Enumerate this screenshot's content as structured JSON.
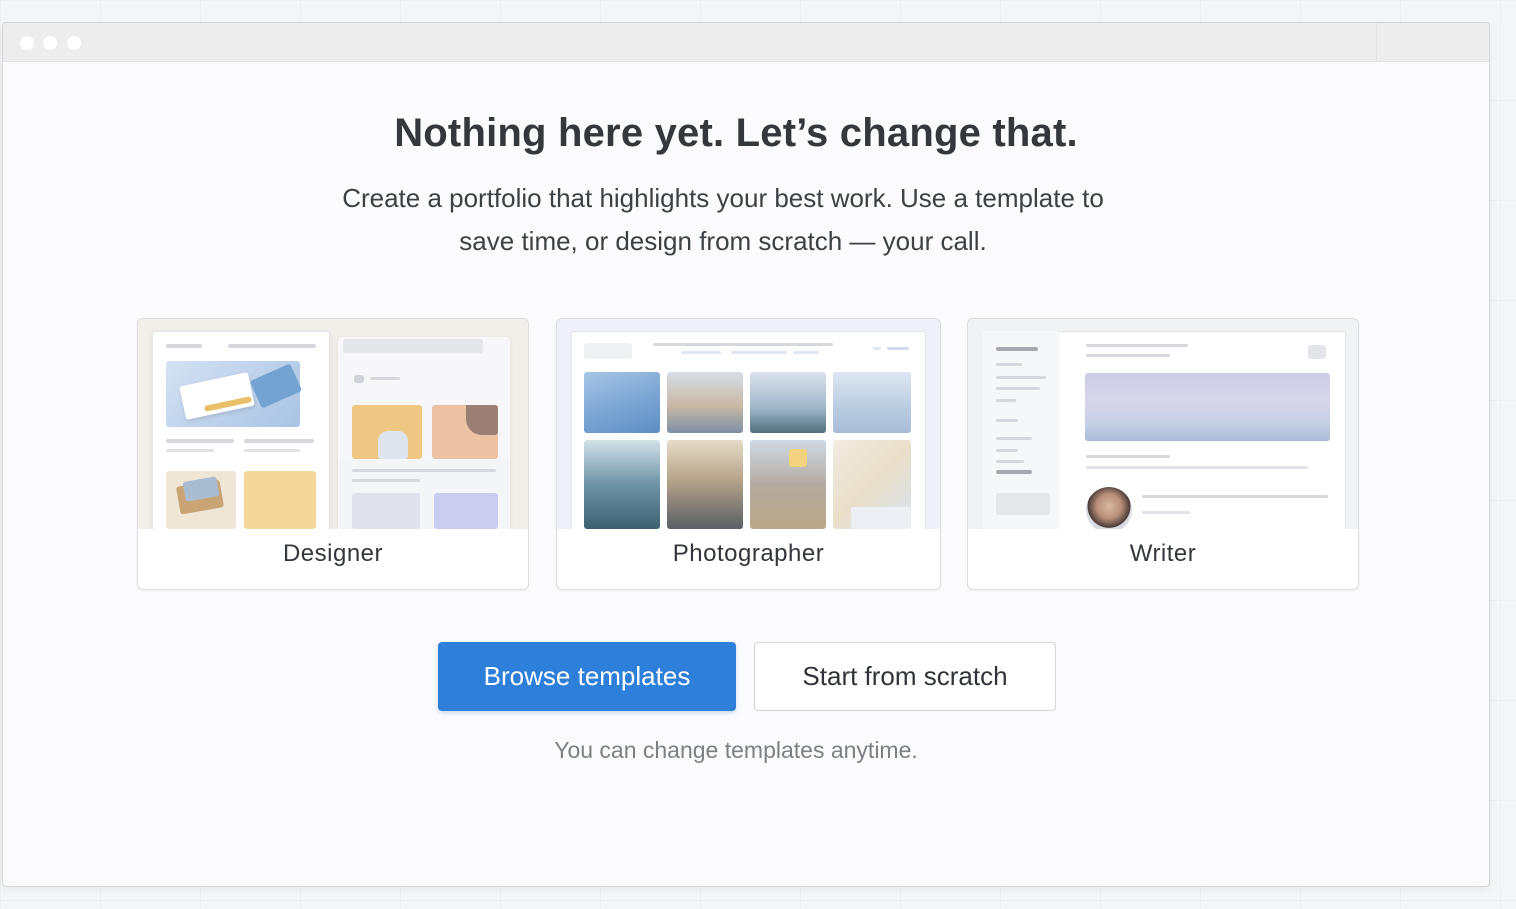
{
  "window": {
    "controls": [
      "window-dot-icon",
      "window-dot-icon",
      "window-dot-icon"
    ]
  },
  "empty_state": {
    "headline": "Nothing here yet. Let’s change that.",
    "subtitle_line1": "Create a portfolio that highlights your best work. Use a template to",
    "subtitle_line2": "save time, or design from scratch — your call."
  },
  "template_cards": [
    {
      "label": "Designer"
    },
    {
      "label": "Photographer"
    },
    {
      "label": "Writer"
    }
  ],
  "actions": {
    "primary_label": "Browse templates",
    "secondary_label": "Start from scratch",
    "note": "You can change templates anytime."
  },
  "colors": {
    "primary": "#2e7fd9",
    "text": "#34373c",
    "muted": "#7c7f84",
    "background": "#fbfbfd"
  }
}
